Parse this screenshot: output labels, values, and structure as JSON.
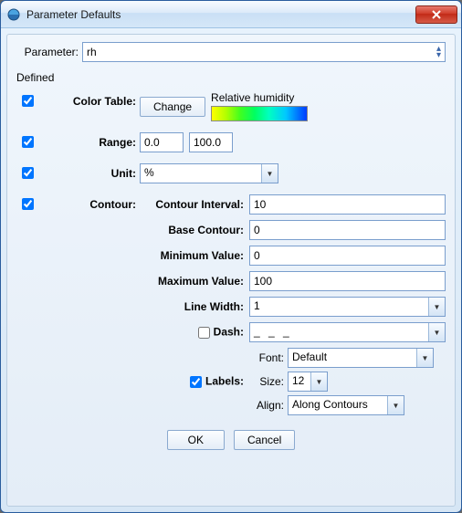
{
  "window": {
    "title": "Parameter Defaults"
  },
  "param": {
    "label": "Parameter:",
    "value": "rh"
  },
  "defined_label": "Defined",
  "color_table": {
    "label": "Color Table:",
    "button": "Change",
    "swatch_label": "Relative humidity"
  },
  "range": {
    "label": "Range:",
    "min": "0.0",
    "max": "100.0"
  },
  "unit": {
    "label": "Unit:",
    "value": "%"
  },
  "contour": {
    "label": "Contour:",
    "interval_label": "Contour Interval:",
    "interval": "10",
    "base_label": "Base Contour:",
    "base": "0",
    "min_label": "Minimum Value:",
    "min": "0",
    "max_label": "Maximum Value:",
    "max": "100",
    "linewidth_label": "Line Width:",
    "linewidth": "1",
    "dash_label": "Dash:",
    "dash_value": "_ _ _",
    "labels_label": "Labels:",
    "font_label": "Font:",
    "font_value": "Default",
    "size_label": "Size:",
    "size_value": "12",
    "align_label": "Align:",
    "align_value": "Along Contours"
  },
  "buttons": {
    "ok": "OK",
    "cancel": "Cancel"
  }
}
